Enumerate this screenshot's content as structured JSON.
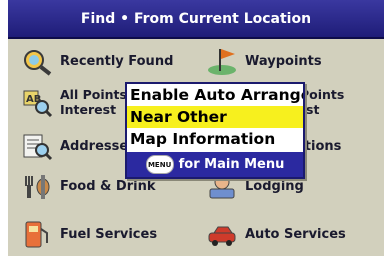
{
  "header": {
    "title": "Find • From Current Location"
  },
  "menu_items": [
    {
      "label": "Recently Found",
      "icon": "recently-found-icon"
    },
    {
      "label": "Waypoints",
      "icon": "waypoints-flag-icon"
    },
    {
      "label_line1": "All Points of",
      "label_line2": "Interest",
      "icon": "all-poi-icon"
    },
    {
      "label_line1": "Nearby Points",
      "label_line2": "of Interest",
      "icon": "nearby-poi-icon"
    },
    {
      "label": "Addresses",
      "icon": "addresses-icon"
    },
    {
      "label": "Intersections",
      "icon": "intersections-icon"
    },
    {
      "label": "Food & Drink",
      "icon": "food-drink-icon"
    },
    {
      "label": "Lodging",
      "icon": "lodging-icon"
    },
    {
      "label": "Fuel Services",
      "icon": "fuel-pump-icon"
    },
    {
      "label": "Auto Services",
      "icon": "auto-services-icon"
    }
  ],
  "popup": {
    "options": [
      "Enable Auto Arrange",
      "Near Other",
      "Map Information"
    ],
    "selected_index": 1,
    "footer_key": "MENU",
    "footer_text": "for Main Menu"
  },
  "colors": {
    "title_bar": "#2a289a",
    "background": "#d2d0bd",
    "highlight": "#f7f01e",
    "footer": "#2b29a0"
  }
}
